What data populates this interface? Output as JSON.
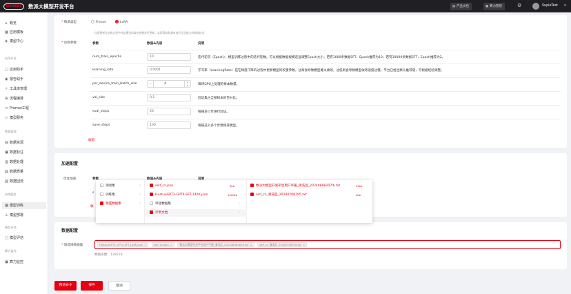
{
  "header": {
    "logo_text": "SUPREDT",
    "title": "数派大模型开发平台",
    "docs_button": "产品文档",
    "compute_button": "算力管理",
    "username": "SupieTest"
  },
  "sidebar": {
    "top_items": [
      "概览",
      "应用模板",
      "模型中心"
    ],
    "groups": [
      {
        "label": "应用开发",
        "items": [
          "应用助手",
          "报告助手",
          "工具库管理",
          "流程编排",
          "Prompt工程",
          "模型服务"
        ]
      },
      {
        "label": "数据管理",
        "items": [
          "数据资源",
          "数据标注",
          "数据处理",
          "数据质量",
          "数据回流"
        ]
      },
      {
        "label": "训练服务",
        "items": [
          "模型训练",
          "模型部署"
        ]
      },
      {
        "label": "模型评估",
        "items": [
          "模型评估"
        ]
      },
      {
        "label": "算力监控",
        "items": [
          "算力监控"
        ]
      }
    ],
    "active_item": "模型训练"
  },
  "method": {
    "label": "微调类型",
    "options": [
      "Freeze",
      "LoRA"
    ],
    "selected": "LoRA",
    "hint": "仅需更新在训练过程中特定模型的某些参数进行更新，实现高效和具有良好泛化能力的微调技术"
  },
  "params": {
    "label": "训练参数",
    "columns": [
      "参数",
      "数值&内容",
      "说明"
    ],
    "rows": [
      {
        "name": "num_train_epochs",
        "value": "10",
        "desc": "迭代轮次（Epoch），模型训练过程中的迭代轮数。可以根据数据规模适当调整Epoch大小，若有1000条数据SFT，Epoch推荐为10，若有10000条数据SFT，Epoch推荐为2。"
      },
      {
        "name": "learning_rate",
        "value": "0.0001",
        "desc": "学习率（LearningRate）是在梯度下降的过程中更新模型的权重参数，过高会导致模型难以收敛，过低则会导致模型收敛速度过慢，平台已给出默认推荐值，可根据经验调整。"
      },
      {
        "name": "per_device_train_batch_size",
        "value": "4",
        "desc": "每块GPU上处理的样本数量。"
      },
      {
        "name": "val_size",
        "value": "0.1",
        "desc": "验证集占全部样本的百分比。"
      },
      {
        "name": "eval_steps",
        "value": "20",
        "desc": "每隔多少步进行验证。"
      },
      {
        "name": "save_steps",
        "value": "100",
        "desc": "每隔这么多个步骤保存模型。"
      }
    ],
    "collapse_link": "收起"
  },
  "advanced": {
    "title": "加速配置",
    "label": "优化加速",
    "col_param": "参数",
    "col_value": "数值&内容",
    "col_desc": "说明",
    "row_prefix": "s",
    "collapse_link": "收"
  },
  "cascader": {
    "level1": [
      {
        "label": "测试集",
        "checked": false
      },
      {
        "label": "训练集",
        "checked": false
      },
      {
        "label": "预置数据集",
        "checked": true
      }
    ],
    "level2": [
      {
        "label": "self_cz.json",
        "checked": true,
        "size": "3kb"
      },
      {
        "label": "HuatuoGPT2-GPT4-SFT-140K.json",
        "checked": true,
        "size": "1000kb"
      },
      {
        "label": "评估数据集",
        "checked": false,
        "size": ""
      },
      {
        "label": "示例文档",
        "checked": true,
        "size": ""
      }
    ],
    "level3": [
      {
        "label": "数派大模型开发平台用户手册_清洗后_20240808207lb.txt",
        "checked": true,
        "size": "49kb"
      },
      {
        "label": "self_cz_清洗后_20240708795.txt",
        "checked": true,
        "size": "0kb"
      }
    ]
  },
  "dataset": {
    "title": "数据配置",
    "label": "请选择数据集",
    "tags": [
      "HuatuoGPT2-GPT4-SFT-140K.json",
      "self_cz.json",
      "数派大模型开发平台用户手册_清洗后_202408082876.txt",
      "self_cz_清洗后_20240708708.txt"
    ],
    "count_label": "数据条数：",
    "count_value": "138219"
  },
  "footer": {
    "preview_button": "预览命令",
    "save_button": "保存",
    "cancel_button": "取消"
  }
}
